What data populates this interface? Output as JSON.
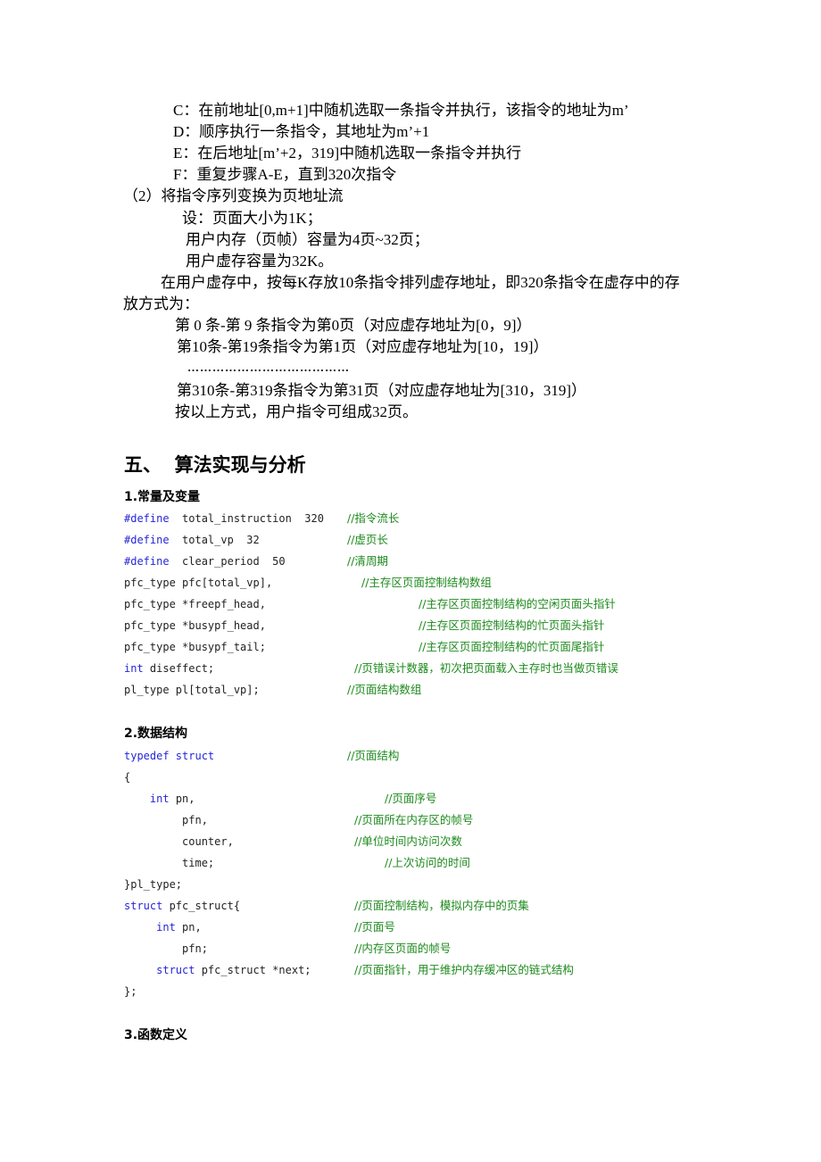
{
  "section_four_tail": {
    "steps": [
      "C：在前地址[0,m+1]中随机选取一条指令并执行，该指令的地址为m’",
      "D：顺序执行一条指令，其地址为m’+1",
      "E：在后地址[m’+2，319]中随机选取一条指令并执行",
      "F：重复步骤A-E，直到320次指令"
    ],
    "subsection_2": "（2）将指令序列变换为页地址流",
    "assumptions": [
      "设：页面大小为1K；",
      "用户内存（页帧）容量为4页~32页；",
      "用户虚存容量为32K。"
    ],
    "paragraph_line1": "在用户虚存中，按每K存放10条指令排列虚存地址，即320条指令在虚存中的存",
    "paragraph_line2": "放方式为：",
    "mapping": [
      "第 0 条-第 9 条指令为第0页（对应虚存地址为[0，9]）",
      "第10条-第19条指令为第1页（对应虚存地址为[10，19]）",
      "…………………………………",
      "第310条-第319条指令为第31页（对应虚存地址为[310，319]）",
      "按以上方式，用户指令可组成32页。"
    ]
  },
  "section_five": {
    "title": "五、  算法实现与分析",
    "sub1": {
      "title": "1.常量及变量",
      "lines": [
        {
          "kw": "#define",
          "code": "  total_instruction  320",
          "comment": "//指令流长"
        },
        {
          "kw": "#define",
          "code": "  total_vp  32",
          "comment": "//虚页长"
        },
        {
          "kw": "#define",
          "code": "  clear_period  50",
          "comment": "//清周期"
        },
        {
          "kw": "",
          "code": "pfc_type pfc[total_vp],",
          "comment": "//主存区页面控制结构数组"
        },
        {
          "kw": "",
          "code": "pfc_type *freepf_head,",
          "comment": "//主存区页面控制结构的空闲页面头指针"
        },
        {
          "kw": "",
          "code": "pfc_type *busypf_head,",
          "comment": "//主存区页面控制结构的忙页面头指针"
        },
        {
          "kw": "",
          "code": "pfc_type *busypf_tail;",
          "comment": "//主存区页面控制结构的忙页面尾指针"
        },
        {
          "kw": "int",
          "code": " diseffect;",
          "comment": "//页错误计数器，初次把页面载入主存时也当做页错误"
        },
        {
          "kw": "",
          "code": "pl_type pl[total_vp];",
          "comment": "//页面结构数组"
        }
      ]
    },
    "sub2": {
      "title": "2.数据结构",
      "lines": [
        {
          "indent": "",
          "kw": "typedef struct",
          "code": "",
          "comment": "//页面结构"
        },
        {
          "indent": "",
          "kw": "",
          "code": "{",
          "comment": ""
        },
        {
          "indent": "    ",
          "kw": "int",
          "code": " pn,",
          "comment": "//页面序号"
        },
        {
          "indent": "         ",
          "kw": "",
          "code": "pfn,",
          "comment": "//页面所在内存区的帧号"
        },
        {
          "indent": "         ",
          "kw": "",
          "code": "counter,",
          "comment": "//单位时间内访问次数"
        },
        {
          "indent": "         ",
          "kw": "",
          "code": "time;",
          "comment": "//上次访问的时间"
        },
        {
          "indent": "",
          "kw": "",
          "code": "}pl_type;",
          "comment": ""
        },
        {
          "indent": "",
          "kw": "struct",
          "code": " pfc_struct{",
          "comment": "//页面控制结构，模拟内存中的页集"
        },
        {
          "indent": "     ",
          "kw": "int",
          "code": " pn,",
          "comment": "//页面号"
        },
        {
          "indent": "         ",
          "kw": "",
          "code": "pfn;",
          "comment": "//内存区页面的帧号"
        },
        {
          "indent": "     ",
          "kw": "struct",
          "code": " pfc_struct *next;",
          "comment": "//页面指针，用于维护内存缓冲区的链式结构"
        },
        {
          "indent": "",
          "kw": "",
          "code": "};",
          "comment": ""
        }
      ]
    },
    "sub3": {
      "title": "3.函数定义"
    }
  },
  "colors": {
    "keyword": "#2626d9",
    "comment": "#1d8a1d",
    "text": "#000000"
  }
}
